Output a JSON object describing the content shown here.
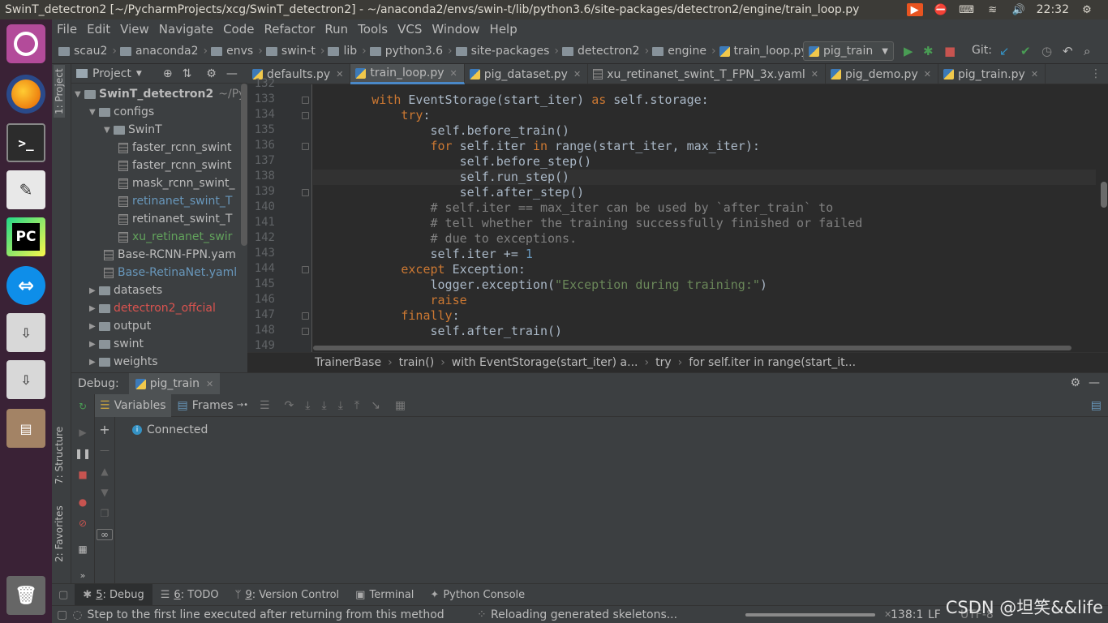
{
  "window": {
    "title": "SwinT_detectron2 [~/PycharmProjects/xcg/SwinT_detectron2] - ~/anaconda2/envs/swin-t/lib/python3.6/site-packages/detectron2/engine/train_loop.py"
  },
  "tray": {
    "time": "22:32"
  },
  "menu": [
    "File",
    "Edit",
    "View",
    "Navigate",
    "Code",
    "Refactor",
    "Run",
    "Tools",
    "VCS",
    "Window",
    "Help"
  ],
  "breadcrumbs": [
    "scau2",
    "anaconda2",
    "envs",
    "swin-t",
    "lib",
    "python3.6",
    "site-packages",
    "detectron2",
    "engine",
    "train_loop.py"
  ],
  "run_config": "pig_train",
  "git_label": "Git:",
  "left_strip": {
    "project": "1: Project",
    "structure": "7: Structure",
    "favorites": "2: Favorites"
  },
  "project": {
    "header": "Project",
    "root": "SwinT_detectron2",
    "root_path": "~/Pyc",
    "items": [
      {
        "label": "configs",
        "kind": "folder",
        "depth": 1,
        "open": true
      },
      {
        "label": "SwinT",
        "kind": "folder",
        "depth": 2,
        "open": true
      },
      {
        "label": "faster_rcnn_swint",
        "kind": "yaml",
        "depth": 3,
        "color": "#bbbbbb"
      },
      {
        "label": "faster_rcnn_swint",
        "kind": "yaml",
        "depth": 3,
        "color": "#bbbbbb"
      },
      {
        "label": "mask_rcnn_swint_",
        "kind": "yaml",
        "depth": 3,
        "color": "#bbbbbb"
      },
      {
        "label": "retinanet_swint_T",
        "kind": "yaml",
        "depth": 3,
        "color": "#6897bb"
      },
      {
        "label": "retinanet_swint_T",
        "kind": "yaml",
        "depth": 3,
        "color": "#bbbbbb"
      },
      {
        "label": "xu_retinanet_swir",
        "kind": "yaml",
        "depth": 3,
        "color": "#62a35c"
      },
      {
        "label": "Base-RCNN-FPN.yam",
        "kind": "yaml",
        "depth": 2,
        "color": "#bbbbbb"
      },
      {
        "label": "Base-RetinaNet.yaml",
        "kind": "yaml",
        "depth": 2,
        "color": "#6897bb"
      },
      {
        "label": "datasets",
        "kind": "folder",
        "depth": 1,
        "open": false
      },
      {
        "label": "detectron2_offcial",
        "kind": "folder",
        "depth": 1,
        "open": false,
        "color": "#d9534f"
      },
      {
        "label": "output",
        "kind": "folder",
        "depth": 1,
        "open": false
      },
      {
        "label": "swint",
        "kind": "folder",
        "depth": 1,
        "open": false
      },
      {
        "label": "weights",
        "kind": "folder",
        "depth": 1,
        "open": false
      }
    ]
  },
  "tabs": [
    {
      "label": "defaults.py",
      "active": false
    },
    {
      "label": "train_loop.py",
      "active": true
    },
    {
      "label": "pig_dataset.py",
      "active": false
    },
    {
      "label": "xu_retinanet_swint_T_FPN_3x.yaml",
      "active": false
    },
    {
      "label": "pig_demo.py",
      "active": false
    },
    {
      "label": "pig_train.py",
      "active": false
    }
  ],
  "code": {
    "lines": [
      {
        "n": "132",
        "t": ""
      },
      {
        "n": "133",
        "t": "        <span class=\"kw\">with</span> EventStorage(start_iter) <span class=\"kw\">as</span> self.storage:"
      },
      {
        "n": "134",
        "t": "            <span class=\"kw\">try</span>:"
      },
      {
        "n": "135",
        "t": "                self.before_train()"
      },
      {
        "n": "136",
        "t": "                <span class=\"kw\">for</span> self.iter <span class=\"kw\">in</span> range(start_iter, max_iter):"
      },
      {
        "n": "137",
        "t": "                    self.before_step()"
      },
      {
        "n": "138",
        "t": "                    self.run_step()"
      },
      {
        "n": "139",
        "t": "                    self.after_step()"
      },
      {
        "n": "140",
        "t": "                <span class=\"cm\"># self.iter == max_iter can be used by `after_train` to</span>"
      },
      {
        "n": "141",
        "t": "                <span class=\"cm\"># tell whether the training successfully finished or failed</span>"
      },
      {
        "n": "142",
        "t": "                <span class=\"cm\"># due to exceptions.</span>"
      },
      {
        "n": "143",
        "t": "                self.iter += <span class=\"num\">1</span>"
      },
      {
        "n": "144",
        "t": "            <span class=\"kw\">except</span> Exception:"
      },
      {
        "n": "145",
        "t": "                logger.exception(<span class=\"str\">\"Exception during training:\"</span>)"
      },
      {
        "n": "146",
        "t": "                <span class=\"kw\">raise</span>"
      },
      {
        "n": "147",
        "t": "            <span class=\"kw\">finally</span>:"
      },
      {
        "n": "148",
        "t": "                self.after_train()"
      },
      {
        "n": "149",
        "t": ""
      }
    ]
  },
  "editor_breadcrumb": [
    "TrainerBase",
    "train()",
    "with EventStorage(start_iter) a...",
    "try",
    "for self.iter in range(start_it..."
  ],
  "debug": {
    "label": "Debug:",
    "session": "pig_train",
    "variables_tab": "Variables",
    "frames_tab": "Frames",
    "status": "Connected"
  },
  "bottom_tabs": [
    {
      "key": "5",
      "label": ": Debug",
      "active": true
    },
    {
      "key": "6",
      "label": ": TODO",
      "active": false
    },
    {
      "key": "9",
      "label": ": Version Control",
      "active": false
    },
    {
      "key": "",
      "label": "Terminal",
      "active": false
    },
    {
      "key": "",
      "label": "Python Console",
      "active": false
    }
  ],
  "status": {
    "message": "Step to the first line executed after returning from this method",
    "progress": "Reloading generated skeletons...",
    "position": "138:1",
    "line_sep": "LF",
    "encoding": "UTF-8",
    "watermark": "CSDN @坦笑&&life"
  },
  "colors": {
    "accent": "#4a88c7",
    "keyword": "#cc7832",
    "string": "#6a8759",
    "comment": "#808080",
    "number": "#6897bb"
  }
}
